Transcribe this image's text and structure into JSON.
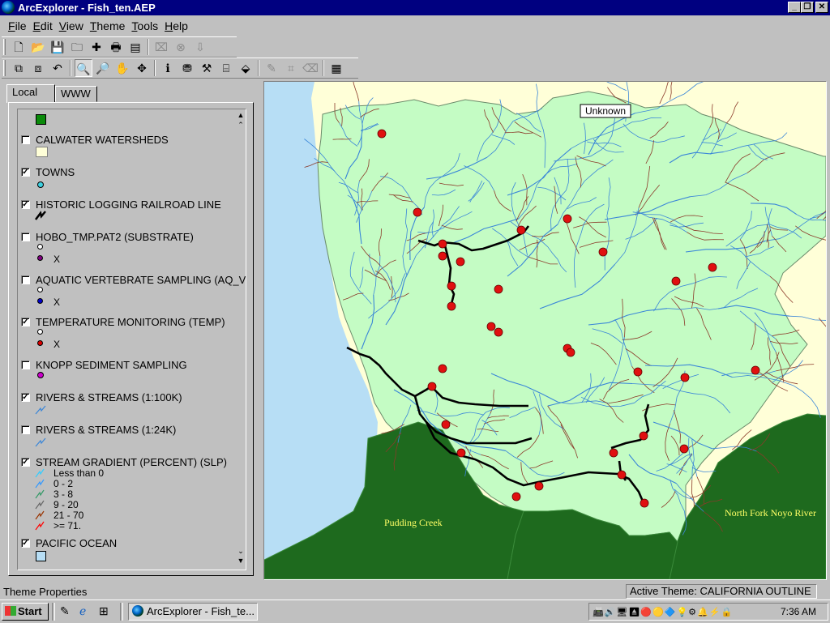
{
  "window": {
    "title": "ArcExplorer - Fish_ten.AEP",
    "minimize_glyph": "_",
    "restore_glyph": "❐",
    "close_glyph": "✕"
  },
  "menu": [
    "File",
    "Edit",
    "View",
    "Theme",
    "Tools",
    "Help"
  ],
  "toolbar1": [
    {
      "name": "new-project-button",
      "icon": "new-icon",
      "glyph": "🗋"
    },
    {
      "name": "open-project-button",
      "icon": "open-folder-icon",
      "glyph": "📂"
    },
    {
      "name": "save-project-button",
      "icon": "save-icon",
      "glyph": "💾"
    },
    {
      "name": "open-database-button",
      "icon": "database-folder-icon",
      "glyph": "🗀"
    },
    {
      "name": "add-theme-button",
      "icon": "plus-icon",
      "glyph": "✚"
    },
    {
      "name": "print-button",
      "icon": "printer-icon",
      "glyph": "🖶"
    },
    {
      "name": "toggle-legend-button",
      "icon": "legend-icon",
      "glyph": "▤"
    },
    {
      "name": "tool-disabled-1",
      "icon": "disabled-tool-icon",
      "glyph": "⌧"
    },
    {
      "name": "tool-disabled-2",
      "icon": "cancel-icon",
      "glyph": "⊗"
    },
    {
      "name": "tool-disabled-3",
      "icon": "export-icon",
      "glyph": "⇩"
    }
  ],
  "toolbar2": [
    {
      "name": "add-layer-button",
      "icon": "layer-add-icon",
      "glyph": "⧉"
    },
    {
      "name": "remove-layer-button",
      "icon": "layer-remove-icon",
      "glyph": "⧈"
    },
    {
      "name": "undo-extent-button",
      "icon": "undo-icon",
      "glyph": "↶"
    },
    {
      "name": "zoom-in-button",
      "icon": "zoom-in-icon",
      "glyph": "🔍",
      "pressed": true
    },
    {
      "name": "zoom-out-button",
      "icon": "zoom-out-icon",
      "glyph": "🔎"
    },
    {
      "name": "pan-button",
      "icon": "hand-icon",
      "glyph": "✋"
    },
    {
      "name": "move-button",
      "icon": "move-icon",
      "glyph": "✥"
    },
    {
      "name": "identify-button",
      "icon": "info-icon",
      "glyph": "ℹ"
    },
    {
      "name": "find-button",
      "icon": "binoculars-icon",
      "glyph": "⛃"
    },
    {
      "name": "measure-button",
      "icon": "measure-icon",
      "glyph": "⚒"
    },
    {
      "name": "query-button",
      "icon": "query-icon",
      "glyph": "⌸"
    },
    {
      "name": "spatial-select-button",
      "icon": "select-icon",
      "glyph": "⬙"
    },
    {
      "name": "tool-disabled-4",
      "icon": "disabled-pin-icon",
      "glyph": "✎"
    },
    {
      "name": "tool-disabled-5",
      "icon": "disabled-grid-icon",
      "glyph": "⌗"
    },
    {
      "name": "tool-disabled-6",
      "icon": "eraser-icon",
      "glyph": "⌫"
    },
    {
      "name": "properties-button",
      "icon": "properties-icon",
      "glyph": "▦"
    }
  ],
  "tabs": {
    "local": "Local",
    "www": "WWW"
  },
  "legend": [
    {
      "label": "",
      "checked": false,
      "top_only": true
    },
    {
      "label": "CALWATER WATERSHEDS",
      "checked": false
    },
    {
      "label": "TOWNS",
      "checked": true
    },
    {
      "label": "HISTORIC LOGGING RAILROAD LINE",
      "checked": true
    },
    {
      "label": "HOBO_TMP.PAT2 (SUBSTRATE)",
      "checked": false
    },
    {
      "label": "AQUATIC VERTEBRATE SAMPLING (AQ_V",
      "checked": false
    },
    {
      "label": "TEMPERATURE MONITORING (TEMP)",
      "checked": true
    },
    {
      "label": "KNOPP SEDIMENT SAMPLING",
      "checked": false
    },
    {
      "label": "RIVERS & STREAMS (1:100K)",
      "checked": true
    },
    {
      "label": "RIVERS & STREAMS (1:24K)",
      "checked": false
    },
    {
      "label": "STREAM GRADIENT (PERCENT) (SLP)",
      "checked": true
    },
    {
      "label": "PACIFIC OCEAN",
      "checked": true
    }
  ],
  "gradient_classes": [
    "Less than 0",
    "0 - 2",
    "3 - 8",
    "9 - 20",
    "21 - 70",
    ">= 71."
  ],
  "gradient_colors": [
    "#33ccff",
    "#3399ff",
    "#339966",
    "#666666",
    "#993300",
    "#ff0000"
  ],
  "x_mark": "X",
  "map": {
    "label_unknown": "Unknown",
    "label_pudding": "Pudding Creek",
    "label_noyo": "North Fork Noyo River",
    "colors": {
      "ocean": "#b7def5",
      "land": "#ffffd8",
      "watershed": "#c4fcc4",
      "forest": "#1e6a1e",
      "river": "#3a86d8",
      "rail": "#000000",
      "site": "#e01010"
    }
  },
  "status": {
    "left": "Theme Properties",
    "right": "Active Theme: CALIFORNIA OUTLINE"
  },
  "taskbar": {
    "start": "Start",
    "task": "ArcExplorer - Fish_te...",
    "clock": "7:36 AM"
  }
}
